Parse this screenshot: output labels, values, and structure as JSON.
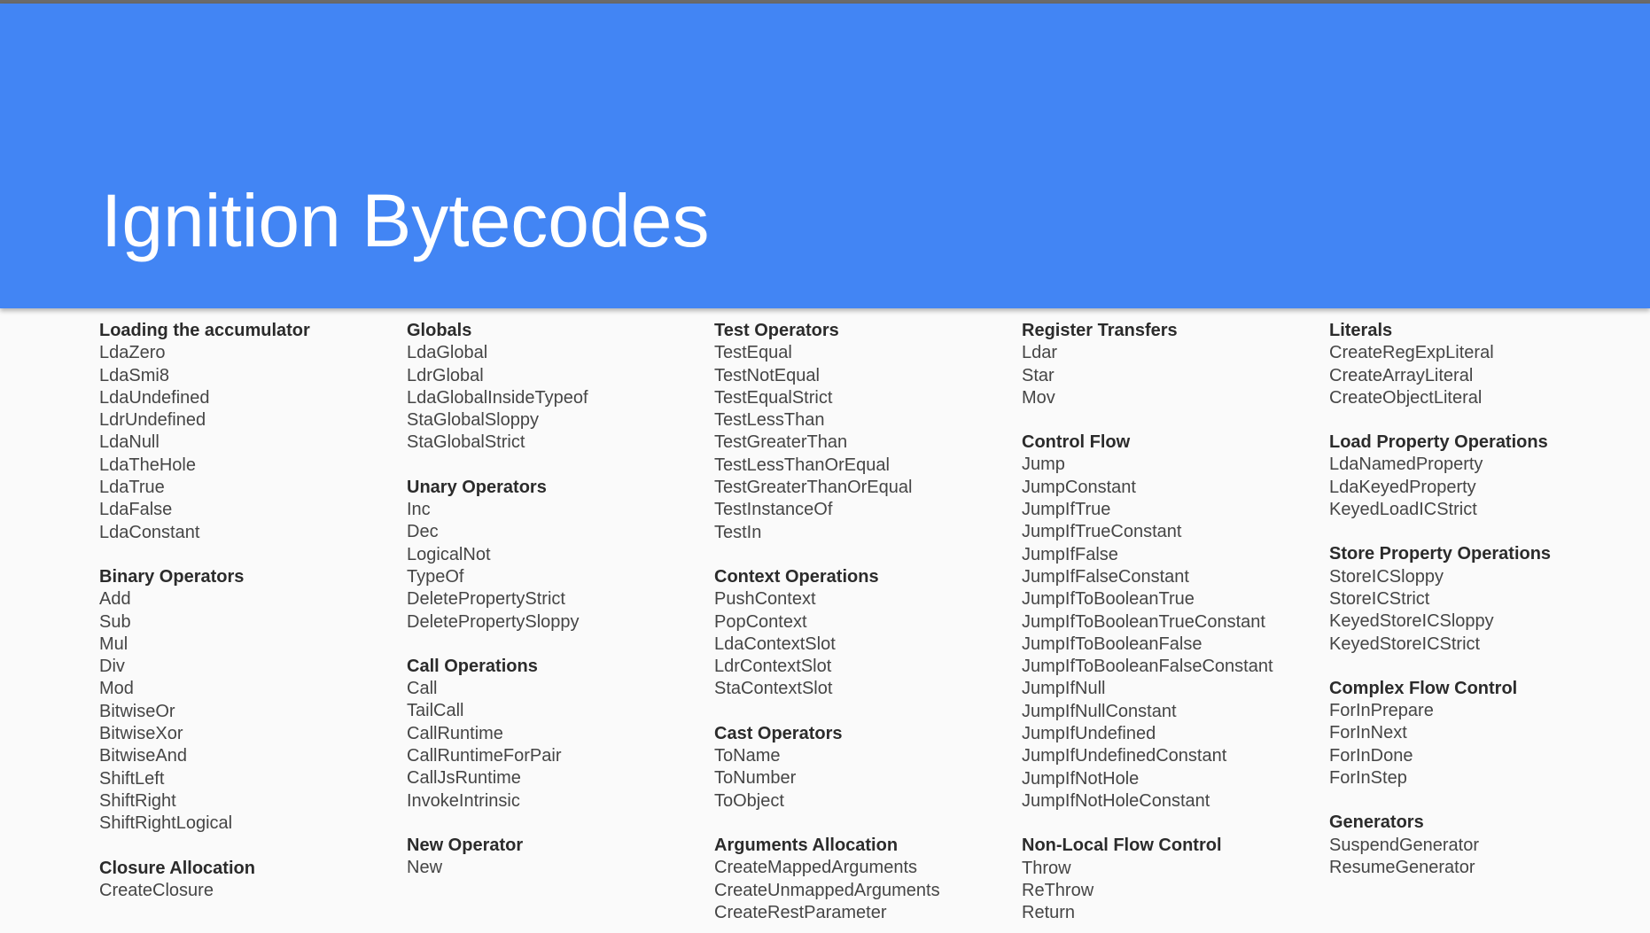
{
  "title": "Ignition Bytecodes",
  "colors": {
    "header": "#4285f4",
    "title": "#ffffff",
    "heading": "#2b2b2b",
    "item": "#454545"
  },
  "columns": [
    {
      "sections": [
        {
          "title": "Loading the accumulator",
          "items": [
            "LdaZero",
            "LdaSmi8",
            "LdaUndefined",
            "LdrUndefined",
            "LdaNull",
            "LdaTheHole",
            "LdaTrue",
            "LdaFalse",
            "LdaConstant"
          ]
        },
        {
          "title": "Binary Operators",
          "items": [
            "Add",
            "Sub",
            "Mul",
            "Div",
            "Mod",
            "BitwiseOr",
            "BitwiseXor",
            "BitwiseAnd",
            "ShiftLeft",
            "ShiftRight",
            "ShiftRightLogical"
          ]
        },
        {
          "title": "Closure Allocation",
          "items": [
            "CreateClosure"
          ]
        }
      ]
    },
    {
      "sections": [
        {
          "title": "Globals",
          "items": [
            "LdaGlobal",
            "LdrGlobal",
            "LdaGlobalInsideTypeof",
            "StaGlobalSloppy",
            "StaGlobalStrict"
          ]
        },
        {
          "title": "Unary Operators",
          "items": [
            "Inc",
            "Dec",
            "LogicalNot",
            "TypeOf",
            "DeletePropertyStrict",
            "DeletePropertySloppy"
          ]
        },
        {
          "title": "Call Operations",
          "items": [
            "Call",
            "TailCall",
            "CallRuntime",
            "CallRuntimeForPair",
            "CallJsRuntime",
            "InvokeIntrinsic"
          ]
        },
        {
          "title": "New Operator",
          "items": [
            "New"
          ]
        }
      ]
    },
    {
      "sections": [
        {
          "title": "Test Operators",
          "items": [
            "TestEqual",
            "TestNotEqual",
            "TestEqualStrict",
            "TestLessThan",
            "TestGreaterThan",
            "TestLessThanOrEqual",
            "TestGreaterThanOrEqual",
            "TestInstanceOf",
            "TestIn"
          ]
        },
        {
          "title": "Context Operations",
          "items": [
            "PushContext",
            "PopContext",
            "LdaContextSlot",
            "LdrContextSlot",
            "StaContextSlot"
          ]
        },
        {
          "title": "Cast Operators",
          "items": [
            "ToName",
            "ToNumber",
            "ToObject"
          ]
        },
        {
          "title": "Arguments Allocation",
          "items": [
            "CreateMappedArguments",
            "CreateUnmappedArguments",
            "CreateRestParameter"
          ]
        }
      ]
    },
    {
      "sections": [
        {
          "title": "Register Transfers",
          "items": [
            "Ldar",
            "Star",
            "Mov"
          ]
        },
        {
          "title": "Control Flow",
          "items": [
            "Jump",
            "JumpConstant",
            "JumpIfTrue",
            "JumpIfTrueConstant",
            "JumpIfFalse",
            "JumpIfFalseConstant",
            "JumpIfToBooleanTrue",
            "JumpIfToBooleanTrueConstant",
            "JumpIfToBooleanFalse",
            "JumpIfToBooleanFalseConstant",
            "JumpIfNull",
            "JumpIfNullConstant",
            "JumpIfUndefined",
            "JumpIfUndefinedConstant",
            "JumpIfNotHole",
            "JumpIfNotHoleConstant"
          ]
        },
        {
          "title": "Non-Local Flow Control",
          "items": [
            "Throw",
            "ReThrow",
            "Return"
          ]
        }
      ]
    },
    {
      "sections": [
        {
          "title": "Literals",
          "items": [
            "CreateRegExpLiteral",
            "CreateArrayLiteral",
            "CreateObjectLiteral"
          ]
        },
        {
          "title": "Load Property Operations",
          "items": [
            "LdaNamedProperty",
            "LdaKeyedProperty",
            "KeyedLoadICStrict"
          ]
        },
        {
          "title": "Store Property Operations",
          "items": [
            "StoreICSloppy",
            "StoreICStrict",
            "KeyedStoreICSloppy",
            "KeyedStoreICStrict"
          ]
        },
        {
          "title": "Complex Flow Control",
          "items": [
            "ForInPrepare",
            "ForInNext",
            "ForInDone",
            "ForInStep"
          ]
        },
        {
          "title": "Generators",
          "items": [
            "SuspendGenerator",
            "ResumeGenerator"
          ]
        }
      ]
    }
  ]
}
